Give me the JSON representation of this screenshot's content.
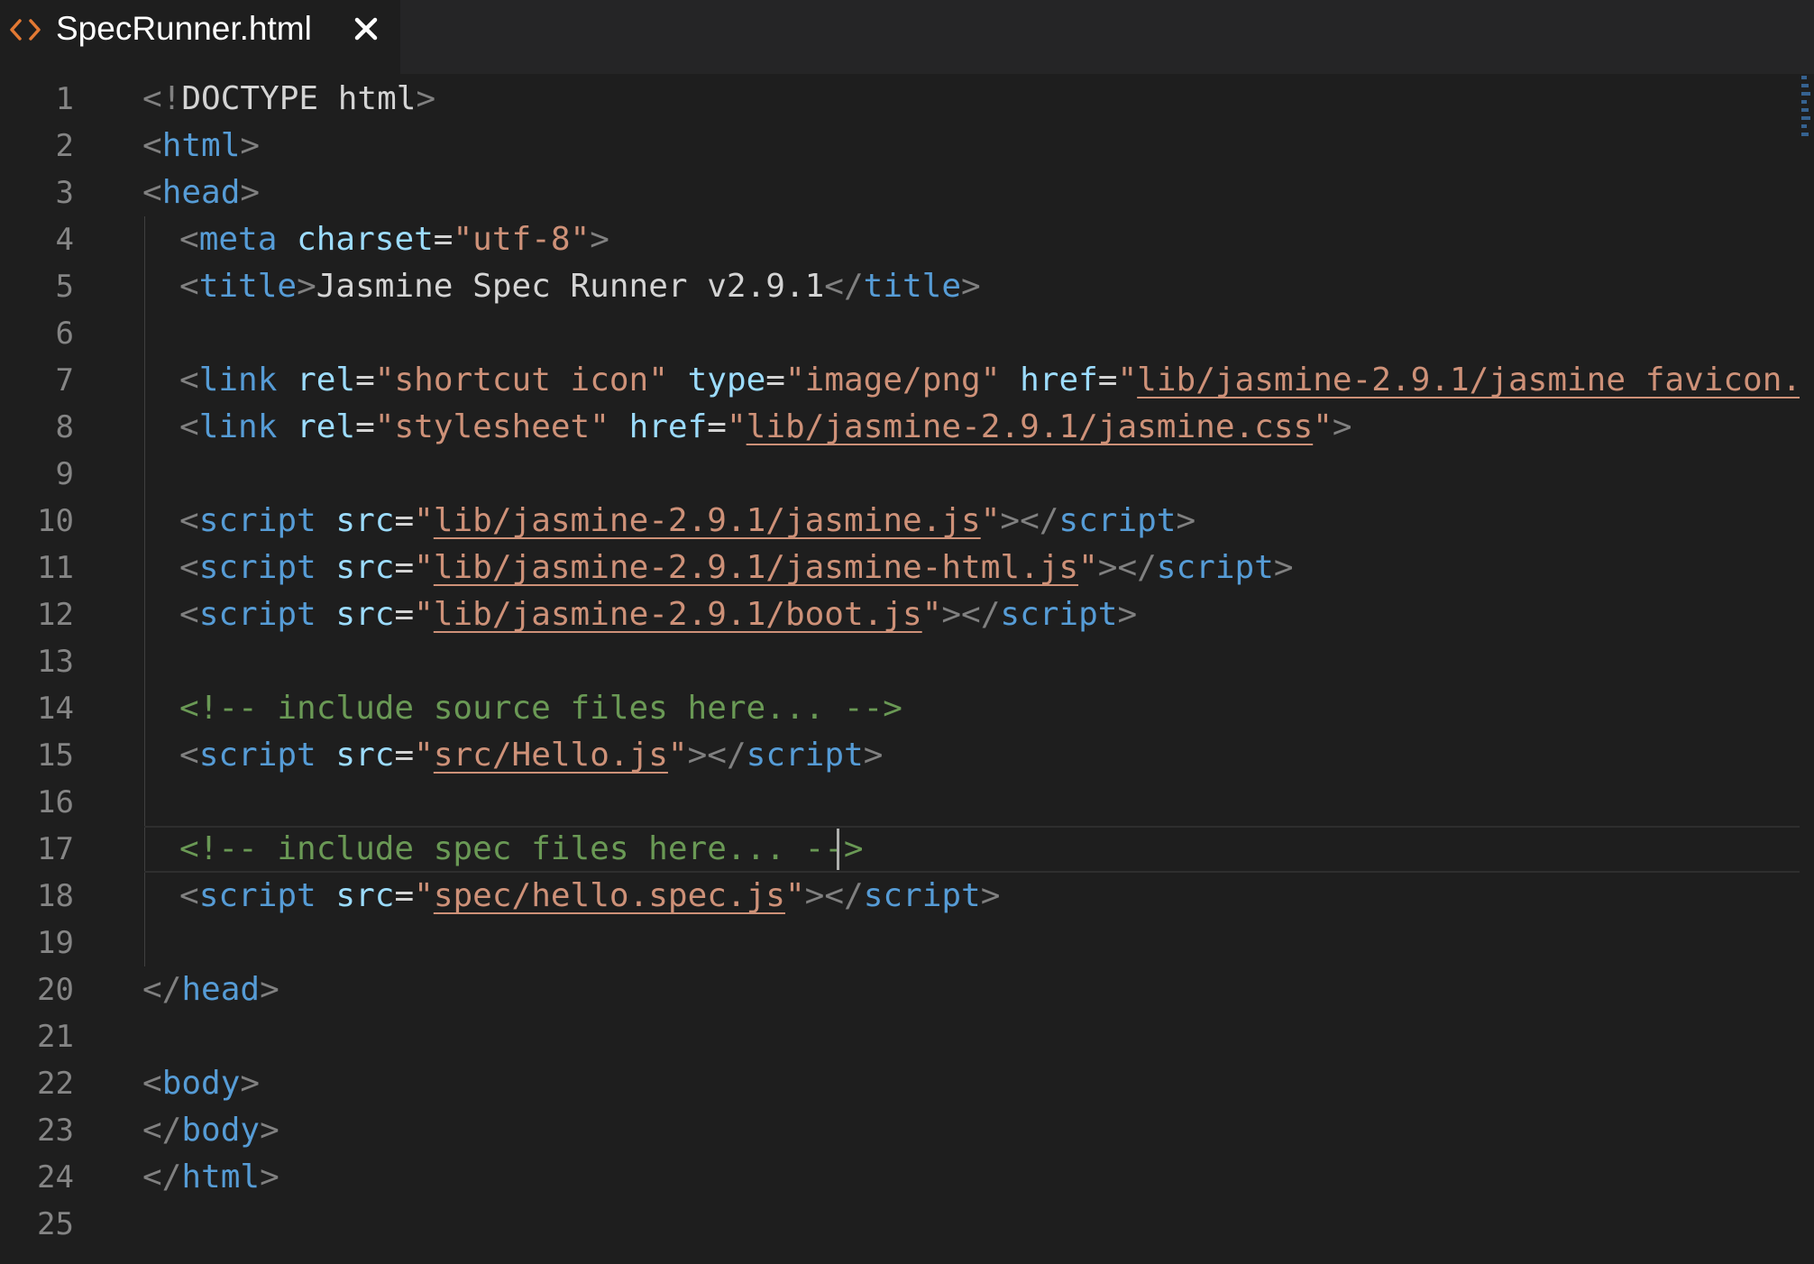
{
  "tab": {
    "title": "SpecRunner.html",
    "icon": "code-file-icon",
    "close_icon": "close-icon"
  },
  "editor": {
    "line_numbers": [
      "1",
      "2",
      "3",
      "4",
      "5",
      "6",
      "7",
      "8",
      "9",
      "10",
      "11",
      "12",
      "13",
      "14",
      "15",
      "16",
      "17",
      "18",
      "19",
      "20",
      "21",
      "22",
      "23",
      "24",
      "25"
    ],
    "current_line": 17,
    "lines": [
      {
        "indent": 0,
        "tokens": [
          [
            "b",
            "<!"
          ],
          [
            "txt",
            "DOCTYPE html"
          ],
          [
            "b",
            ">"
          ]
        ]
      },
      {
        "indent": 0,
        "tokens": [
          [
            "b",
            "<"
          ],
          [
            "tag",
            "html"
          ],
          [
            "b",
            ">"
          ]
        ]
      },
      {
        "indent": 0,
        "tokens": [
          [
            "b",
            "<"
          ],
          [
            "tag",
            "head"
          ],
          [
            "b",
            ">"
          ]
        ]
      },
      {
        "indent": 1,
        "tokens": [
          [
            "b",
            "<"
          ],
          [
            "tag",
            "meta"
          ],
          [
            "txt",
            " "
          ],
          [
            "attr",
            "charset"
          ],
          [
            "txt",
            "="
          ],
          [
            "str",
            "\"utf-8\""
          ],
          [
            "b",
            ">"
          ]
        ]
      },
      {
        "indent": 1,
        "tokens": [
          [
            "b",
            "<"
          ],
          [
            "tag",
            "title"
          ],
          [
            "b",
            ">"
          ],
          [
            "txt",
            "Jasmine Spec Runner v2.9.1"
          ],
          [
            "b",
            "</"
          ],
          [
            "tag",
            "title"
          ],
          [
            "b",
            ">"
          ]
        ]
      },
      {
        "indent": 0,
        "tokens": []
      },
      {
        "indent": 1,
        "tokens": [
          [
            "b",
            "<"
          ],
          [
            "tag",
            "link"
          ],
          [
            "txt",
            " "
          ],
          [
            "attr",
            "rel"
          ],
          [
            "txt",
            "="
          ],
          [
            "str",
            "\"shortcut icon\""
          ],
          [
            "txt",
            " "
          ],
          [
            "attr",
            "type"
          ],
          [
            "txt",
            "="
          ],
          [
            "str",
            "\"image/png\""
          ],
          [
            "txt",
            " "
          ],
          [
            "attr",
            "href"
          ],
          [
            "txt",
            "="
          ],
          [
            "str",
            "\""
          ],
          [
            "link",
            "lib/jasmine-2.9.1/jasmine_favicon.png"
          ],
          [
            "str",
            "\""
          ]
        ]
      },
      {
        "indent": 1,
        "tokens": [
          [
            "b",
            "<"
          ],
          [
            "tag",
            "link"
          ],
          [
            "txt",
            " "
          ],
          [
            "attr",
            "rel"
          ],
          [
            "txt",
            "="
          ],
          [
            "str",
            "\"stylesheet\""
          ],
          [
            "txt",
            " "
          ],
          [
            "attr",
            "href"
          ],
          [
            "txt",
            "="
          ],
          [
            "str",
            "\""
          ],
          [
            "link",
            "lib/jasmine-2.9.1/jasmine.css"
          ],
          [
            "str",
            "\""
          ],
          [
            "b",
            ">"
          ]
        ]
      },
      {
        "indent": 0,
        "tokens": []
      },
      {
        "indent": 1,
        "tokens": [
          [
            "b",
            "<"
          ],
          [
            "tag",
            "script"
          ],
          [
            "txt",
            " "
          ],
          [
            "attr",
            "src"
          ],
          [
            "txt",
            "="
          ],
          [
            "str",
            "\""
          ],
          [
            "link",
            "lib/jasmine-2.9.1/jasmine.js"
          ],
          [
            "str",
            "\""
          ],
          [
            "b",
            "></"
          ],
          [
            "tag",
            "script"
          ],
          [
            "b",
            ">"
          ]
        ]
      },
      {
        "indent": 1,
        "tokens": [
          [
            "b",
            "<"
          ],
          [
            "tag",
            "script"
          ],
          [
            "txt",
            " "
          ],
          [
            "attr",
            "src"
          ],
          [
            "txt",
            "="
          ],
          [
            "str",
            "\""
          ],
          [
            "link",
            "lib/jasmine-2.9.1/jasmine-html.js"
          ],
          [
            "str",
            "\""
          ],
          [
            "b",
            "></"
          ],
          [
            "tag",
            "script"
          ],
          [
            "b",
            ">"
          ]
        ]
      },
      {
        "indent": 1,
        "tokens": [
          [
            "b",
            "<"
          ],
          [
            "tag",
            "script"
          ],
          [
            "txt",
            " "
          ],
          [
            "attr",
            "src"
          ],
          [
            "txt",
            "="
          ],
          [
            "str",
            "\""
          ],
          [
            "link",
            "lib/jasmine-2.9.1/boot.js"
          ],
          [
            "str",
            "\""
          ],
          [
            "b",
            "></"
          ],
          [
            "tag",
            "script"
          ],
          [
            "b",
            ">"
          ]
        ]
      },
      {
        "indent": 0,
        "tokens": []
      },
      {
        "indent": 1,
        "tokens": [
          [
            "com",
            "<!-- include source files here... -->"
          ]
        ]
      },
      {
        "indent": 1,
        "tokens": [
          [
            "b",
            "<"
          ],
          [
            "tag",
            "script"
          ],
          [
            "txt",
            " "
          ],
          [
            "attr",
            "src"
          ],
          [
            "txt",
            "="
          ],
          [
            "str",
            "\""
          ],
          [
            "link",
            "src/Hello.js"
          ],
          [
            "str",
            "\""
          ],
          [
            "b",
            "></"
          ],
          [
            "tag",
            "script"
          ],
          [
            "b",
            ">"
          ]
        ]
      },
      {
        "indent": 0,
        "tokens": []
      },
      {
        "indent": 1,
        "tokens": [
          [
            "com",
            "<!-- include spec files here... -->"
          ]
        ]
      },
      {
        "indent": 1,
        "tokens": [
          [
            "b",
            "<"
          ],
          [
            "tag",
            "script"
          ],
          [
            "txt",
            " "
          ],
          [
            "attr",
            "src"
          ],
          [
            "txt",
            "="
          ],
          [
            "str",
            "\""
          ],
          [
            "link",
            "spec/hello.spec.js"
          ],
          [
            "str",
            "\""
          ],
          [
            "b",
            "></"
          ],
          [
            "tag",
            "script"
          ],
          [
            "b",
            ">"
          ]
        ]
      },
      {
        "indent": 0,
        "tokens": []
      },
      {
        "indent": 0,
        "tokens": [
          [
            "b",
            "</"
          ],
          [
            "tag",
            "head"
          ],
          [
            "b",
            ">"
          ]
        ]
      },
      {
        "indent": 0,
        "tokens": []
      },
      {
        "indent": 0,
        "tokens": [
          [
            "b",
            "<"
          ],
          [
            "tag",
            "body"
          ],
          [
            "b",
            ">"
          ]
        ]
      },
      {
        "indent": 0,
        "tokens": [
          [
            "b",
            "</"
          ],
          [
            "tag",
            "body"
          ],
          [
            "b",
            ">"
          ]
        ]
      },
      {
        "indent": 0,
        "tokens": [
          [
            "b",
            "</"
          ],
          [
            "tag",
            "html"
          ],
          [
            "b",
            ">"
          ]
        ]
      },
      {
        "indent": 0,
        "tokens": []
      }
    ]
  },
  "colors": {
    "background": "#1e1e1e",
    "tag": "#569cd6",
    "attribute": "#9cdcfe",
    "string": "#ce9178",
    "comment": "#6a9955",
    "bracket": "#808080",
    "text": "#d4d4d4",
    "line_number": "#858585"
  }
}
